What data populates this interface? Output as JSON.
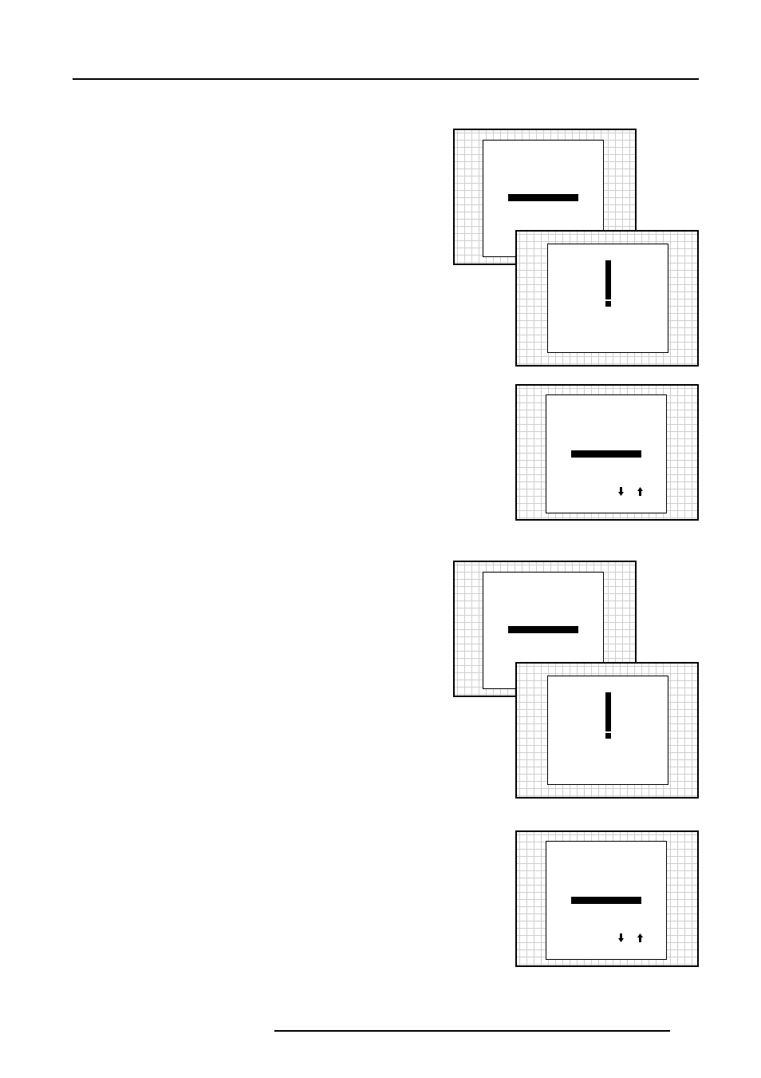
{
  "figures": [
    {
      "screens": [
        {
          "kind": "menu"
        },
        {
          "kind": "warning"
        }
      ]
    },
    {
      "screens": [
        {
          "kind": "adjust"
        }
      ]
    },
    {
      "screens": [
        {
          "kind": "menu"
        },
        {
          "kind": "warning"
        }
      ]
    },
    {
      "screens": [
        {
          "kind": "adjust"
        }
      ]
    }
  ]
}
